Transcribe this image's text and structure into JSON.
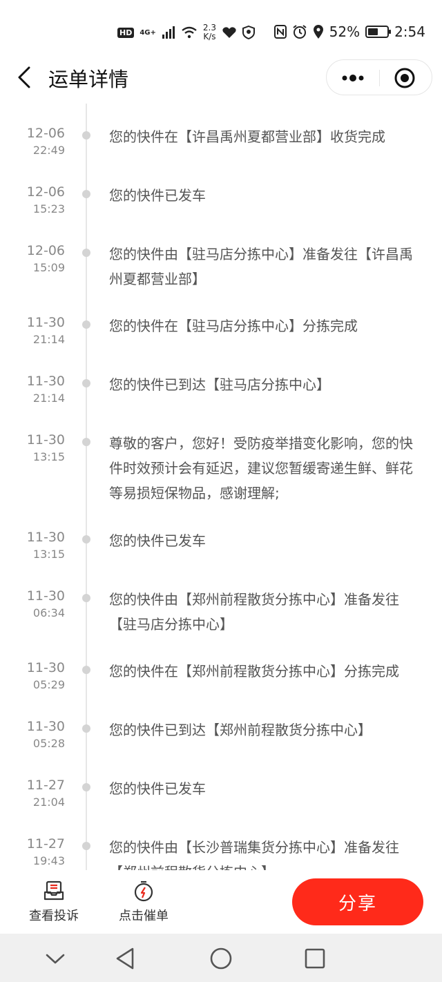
{
  "status_bar": {
    "hd": "HD",
    "network": "4G+",
    "speed_value": "2.3",
    "speed_unit": "K/s",
    "battery_percent": "52%",
    "battery_level": 0.52,
    "time": "2:54"
  },
  "header": {
    "title": "运单详情"
  },
  "timeline": [
    {
      "date": "12-06",
      "time": "22:49",
      "text": "您的快件在【许昌禹州夏都营业部】收货完成"
    },
    {
      "date": "12-06",
      "time": "15:23",
      "text": "您的快件已发车"
    },
    {
      "date": "12-06",
      "time": "15:09",
      "text": "您的快件由【驻马店分拣中心】准备发往【许昌禹州夏都营业部】"
    },
    {
      "date": "11-30",
      "time": "21:14",
      "text": "您的快件在【驻马店分拣中心】分拣完成"
    },
    {
      "date": "11-30",
      "time": "21:14",
      "text": "您的快件已到达【驻马店分拣中心】"
    },
    {
      "date": "11-30",
      "time": "13:15",
      "text": "尊敬的客户，您好！受防疫举措变化影响，您的快件时效预计会有延迟，建议您暂缓寄递生鲜、鲜花等易损短保物品，感谢理解;"
    },
    {
      "date": "11-30",
      "time": "13:15",
      "text": "您的快件已发车"
    },
    {
      "date": "11-30",
      "time": "06:34",
      "text": "您的快件由【郑州前程散货分拣中心】准备发往【驻马店分拣中心】"
    },
    {
      "date": "11-30",
      "time": "05:29",
      "text": "您的快件在【郑州前程散货分拣中心】分拣完成"
    },
    {
      "date": "11-30",
      "time": "05:28",
      "text": "您的快件已到达【郑州前程散货分拣中心】"
    },
    {
      "date": "11-27",
      "time": "21:04",
      "text": "您的快件已发车"
    },
    {
      "date": "11-27",
      "time": "19:43",
      "text": "您的快件由【长沙普瑞集货分拣中心】准备发往【郑州前程散货分拣中心】"
    }
  ],
  "actions": {
    "complain_label": "查看投诉",
    "urge_label": "点击催单",
    "share_label": "分享"
  },
  "colors": {
    "accent": "#ff2a1a",
    "timeline_dot": "#d4d4d4"
  }
}
